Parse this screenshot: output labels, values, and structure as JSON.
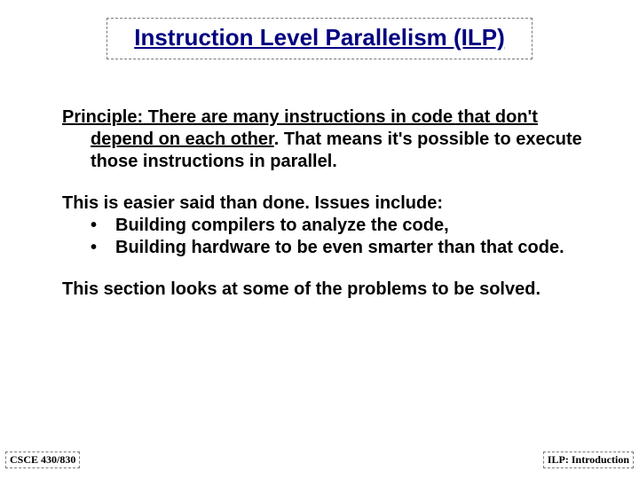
{
  "title": "Instruction Level Parallelism (ILP)",
  "principle": {
    "label": "Principle:",
    "lead": " There are many instructions in code that don't depend on each other",
    "rest": ".  That means it's possible to execute those instructions in parallel."
  },
  "issues": {
    "intro": "This is easier said than done. Issues include:",
    "bullets": [
      "Building compilers to analyze the code,",
      "Building hardware to be even smarter than that code."
    ]
  },
  "closing": "This section looks at some of the problems to be solved.",
  "footer": {
    "left": "CSCE 430/830",
    "right": "ILP: Introduction"
  }
}
